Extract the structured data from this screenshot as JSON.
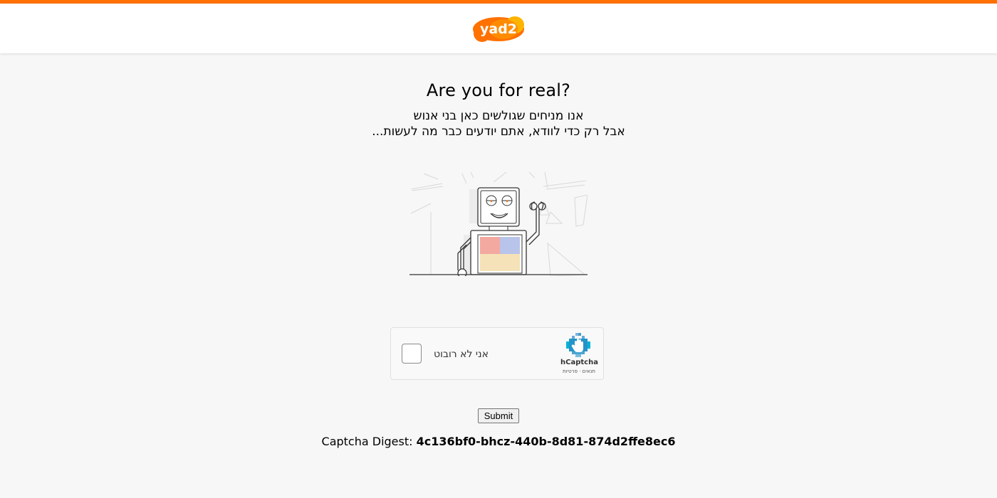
{
  "header": {
    "logo_text": "yad2",
    "accent_color": "#ff7100"
  },
  "main": {
    "title": "Are you for real?",
    "subtitle_line1": "אנו מניחים שגולשים כאן בני אנוש",
    "subtitle_line2": "אבל רק כדי לוודא, אתם יודעים כבר מה לעשות..."
  },
  "captcha": {
    "label": "אני לא רובוט",
    "brand": "hCaptcha",
    "terms_link": "תנאים",
    "separator": "·",
    "privacy_link": "פרטיות",
    "checked": false
  },
  "form": {
    "submit_label": "Submit"
  },
  "digest": {
    "label": "Captcha Digest:",
    "value": "4c136bf0-bhcz-440b-8d81-874d2ffe8ec6"
  },
  "illustration": {
    "icon": "robot-waving-icon"
  }
}
